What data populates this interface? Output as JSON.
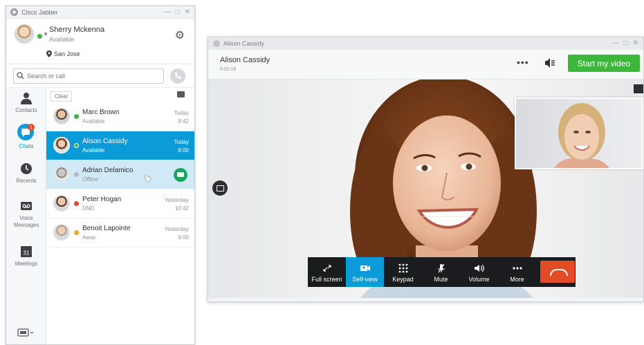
{
  "jabber": {
    "title": "Cisco Jabber",
    "profile": {
      "name": "Sherry Mckenna",
      "status": "Available",
      "location": "San Jose"
    },
    "search": {
      "placeholder": "Search or call"
    },
    "nav": [
      {
        "label": "Contacts",
        "icon": "person-icon"
      },
      {
        "label": "Chats",
        "icon": "chat-bubble-icon",
        "badge": "1"
      },
      {
        "label": "Recents",
        "icon": "clock-icon"
      },
      {
        "label": "Voice Messages",
        "icon": "voicemail-icon"
      },
      {
        "label": "Meetings",
        "icon": "calendar-icon",
        "day": "31"
      }
    ],
    "clear_label": "Clear",
    "contacts": [
      {
        "name": "Marc Brown",
        "status": "Available",
        "date": "Today",
        "time": "8:42",
        "presence": "#3fb24a"
      },
      {
        "name": "Alison Cassidy",
        "status": "Available",
        "date": "Today",
        "time": "8:00",
        "presence": "#3fb24a"
      },
      {
        "name": "Adrian Delamico",
        "status": "Offline",
        "date": "",
        "time": "",
        "presence": "#b5b9bd"
      },
      {
        "name": "Peter Hogan",
        "status": "DND",
        "date": "Yesterday",
        "time": "10:42",
        "presence": "#e0452e"
      },
      {
        "name": "Benoit Lapointe",
        "status": "Away",
        "date": "Yesterday",
        "time": "9:00",
        "presence": "#f2a623"
      }
    ]
  },
  "call": {
    "title": "Alison Cassidy",
    "name": "Alison Cassidy",
    "duration": "0:02:18",
    "more": "•••",
    "start_video": "Start my video",
    "controls": [
      {
        "label": "Full screen",
        "icon": "expand-icon"
      },
      {
        "label": "Self-view",
        "icon": "self-view-icon"
      },
      {
        "label": "Keypad",
        "icon": "keypad-icon"
      },
      {
        "label": "Mute",
        "icon": "microphone-icon"
      },
      {
        "label": "Volume",
        "icon": "volume-icon"
      },
      {
        "label": "More",
        "icon": "more-icon"
      }
    ]
  },
  "colors": {
    "accent": "#0a9bd8",
    "start_video": "#3cb73a",
    "end_call": "#e24b23"
  }
}
